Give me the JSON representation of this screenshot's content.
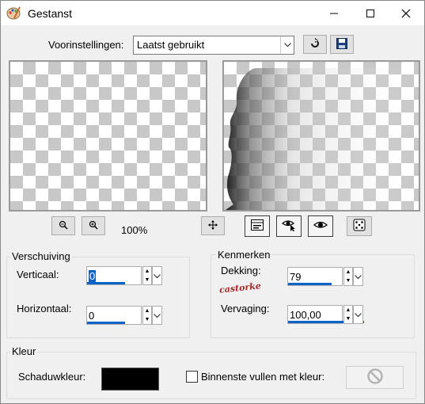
{
  "window": {
    "title": "Gestanst",
    "minimize_icon": "minimize-icon",
    "maximize_icon": "maximize-icon",
    "close_icon": "close-icon"
  },
  "presets": {
    "label": "Voorinstellingen:",
    "value": "Laatst gebruikt",
    "reset_icon": "reset-arrow-icon",
    "save_icon": "floppy-disk-icon"
  },
  "preview": {
    "zoom_out_icon": "zoom-out-icon",
    "zoom_in_icon": "zoom-in-icon",
    "zoom_level": "100%",
    "pan_icon": "move-arrows-icon",
    "proof_icon": "layout-icon",
    "eye_auto_icon": "eye-cursor-icon",
    "eye_icon": "eye-icon",
    "randomize_icon": "dice-icon"
  },
  "offset_group": {
    "title": "Verschuiving",
    "vertical_label": "Verticaal:",
    "vertical_value": "0",
    "horizontal_label": "Horizontaal:",
    "horizontal_value": "0"
  },
  "attributes_group": {
    "title": "Kenmerken",
    "opacity_label": "Dekking:",
    "opacity_value": "79",
    "opacity_fraction": 0.79,
    "blur_label": "Vervaging:",
    "blur_value": "100,00",
    "blur_fraction": 1.0,
    "watermark_text": "castorke"
  },
  "color_group": {
    "title": "Kleur",
    "shadow_color_label": "Schaduwkleur:",
    "shadow_color": "#000000",
    "fill_inside_label": "Binnenste vullen met kleur:",
    "fill_inside_checked": false,
    "fill_color_icon": "no-color-icon"
  },
  "colors": {
    "accent": "#0a64c8",
    "window_bg": "#f0f0f0"
  }
}
